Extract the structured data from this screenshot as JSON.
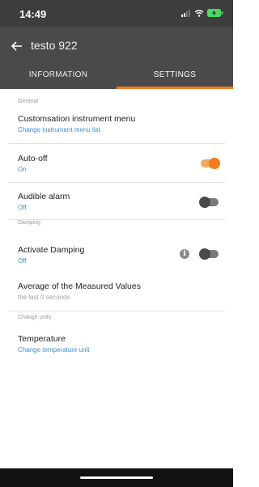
{
  "status_bar": {
    "time": "14:49",
    "icons": [
      "signal-icon",
      "wifi-icon",
      "battery-charging-icon"
    ],
    "battery_color": "#4cd964"
  },
  "app_bar": {
    "title": "testo 922",
    "back_icon": "arrow-left-icon"
  },
  "tabs": [
    {
      "label": "INFORMATION",
      "active": false
    },
    {
      "label": "SETTINGS",
      "active": true
    }
  ],
  "accent_color": "#f47b20",
  "link_color": "#3d8ed1",
  "sections": {
    "general": {
      "header": "General",
      "items": [
        {
          "title": "Customsation instrument menu",
          "subtitle": "Change instrument menu list"
        },
        {
          "title": "Auto-off",
          "subtitle": "On",
          "toggle": true
        },
        {
          "title": "Audible alarm",
          "subtitle": "Off",
          "toggle": false
        }
      ]
    },
    "damping": {
      "header": "Damping",
      "items": [
        {
          "title": "Activate Damping",
          "subtitle": "Off",
          "toggle": false,
          "info_icon": "i"
        },
        {
          "title": "Average of the Measured Values",
          "subtitle": "the last 0 seconds"
        }
      ]
    },
    "units": {
      "header": "Change units",
      "items": [
        {
          "title": "Temperature",
          "subtitle": "Change temperature unit"
        }
      ]
    }
  }
}
